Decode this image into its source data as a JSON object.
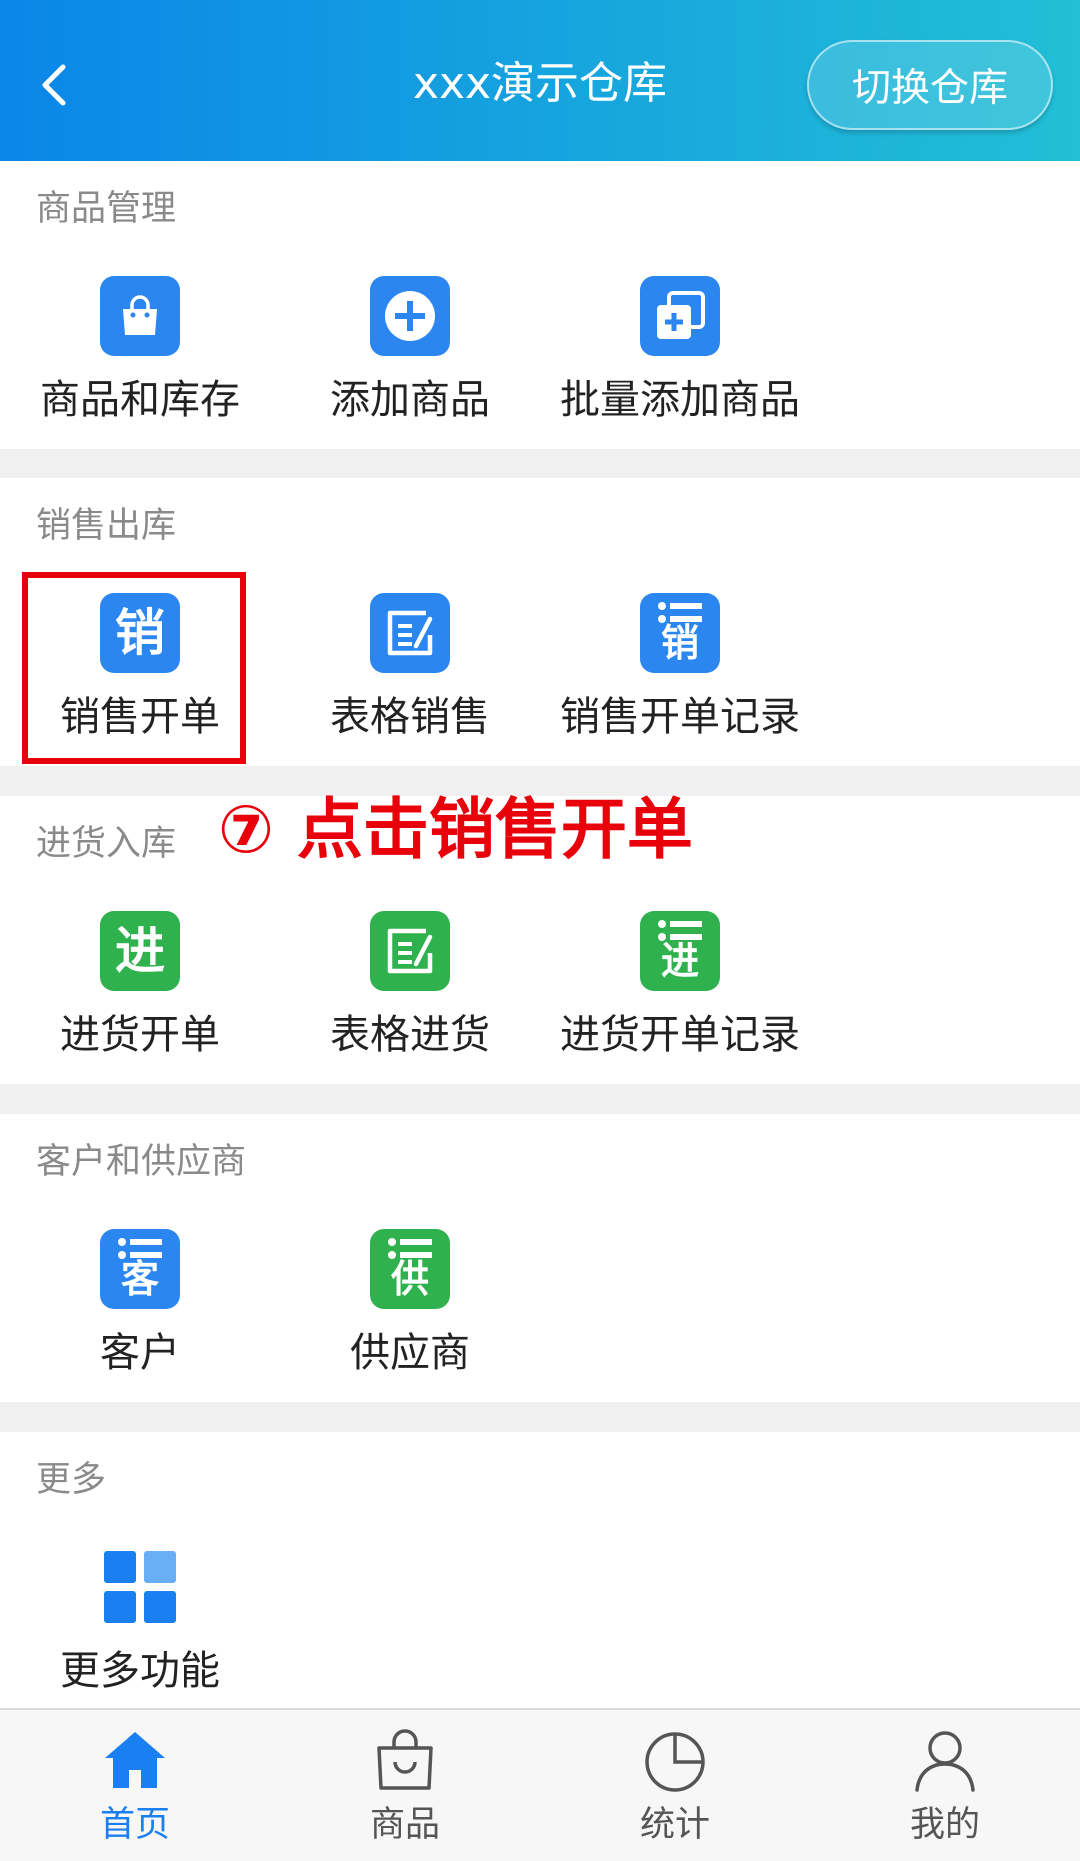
{
  "header": {
    "title": "xxx演示仓库",
    "switch_label": "切换仓库"
  },
  "sections": {
    "goods": {
      "title": "商品管理",
      "items": [
        "商品和库存",
        "添加商品",
        "批量添加商品"
      ]
    },
    "sales": {
      "title": "销售出库",
      "items": [
        "销售开单",
        "表格销售",
        "销售开单记录"
      ],
      "icon_glyph": "销"
    },
    "purchase": {
      "title": "进货入库",
      "items": [
        "进货开单",
        "表格进货",
        "进货开单记录"
      ],
      "icon_glyph": "进"
    },
    "partners": {
      "title": "客户和供应商",
      "items": [
        "客户",
        "供应商"
      ],
      "icon_glyphs": [
        "客",
        "供"
      ]
    },
    "more": {
      "title": "更多",
      "items": [
        "更多功能"
      ]
    }
  },
  "annotation": {
    "text": "⑦ 点击销售开单",
    "color": "#e8000b"
  },
  "tabbar": {
    "items": [
      "首页",
      "商品",
      "统计",
      "我的"
    ],
    "active": "首页",
    "active_color": "#1a7ff0"
  },
  "colors": {
    "header_start": "#0a86e9",
    "header_end": "#22bfd6",
    "icon_blue": "#2b86f0",
    "icon_green": "#2fb14e"
  },
  "icons": {
    "goods": [
      "shopping-bag-icon",
      "add-circle-icon",
      "batch-add-icon"
    ],
    "sales": [
      "sales-icon",
      "form-edit-icon",
      "sales-record-icon"
    ],
    "purchase": [
      "purchase-icon",
      "form-edit-icon",
      "purchase-record-icon"
    ],
    "partners": [
      "customer-icon",
      "supplier-icon"
    ],
    "more": [
      "grid-icon"
    ],
    "tabbar": [
      "home-icon",
      "bag-icon",
      "pie-chart-icon",
      "user-icon"
    ]
  }
}
